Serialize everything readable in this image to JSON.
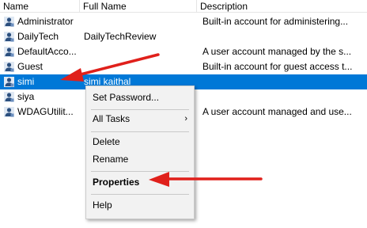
{
  "columns": {
    "name": "Name",
    "full_name": "Full Name",
    "description": "Description"
  },
  "users": [
    {
      "name": "Administrator",
      "full_name": "",
      "description": "Built-in account for administering..."
    },
    {
      "name": "DailyTech",
      "full_name": "DailyTechReview",
      "description": ""
    },
    {
      "name": "DefaultAcco...",
      "full_name": "",
      "description": "A user account managed by the s..."
    },
    {
      "name": "Guest",
      "full_name": "",
      "description": "Built-in account for guest access t..."
    },
    {
      "name": "simi",
      "full_name": "simi kaithal",
      "description": ""
    },
    {
      "name": "siya",
      "full_name": "",
      "description": ""
    },
    {
      "name": "WDAGUtilit...",
      "full_name": "",
      "description": "A user account managed and use..."
    }
  ],
  "context_menu": {
    "set_password": "Set Password...",
    "all_tasks": "All Tasks",
    "delete": "Delete",
    "rename": "Rename",
    "properties": "Properties",
    "help": "Help"
  },
  "icons": {
    "user": "user-account-icon",
    "submenu": "chevron-right-icon"
  },
  "colors": {
    "selection": "#0078d7",
    "annotation_arrow": "#e0201b"
  }
}
